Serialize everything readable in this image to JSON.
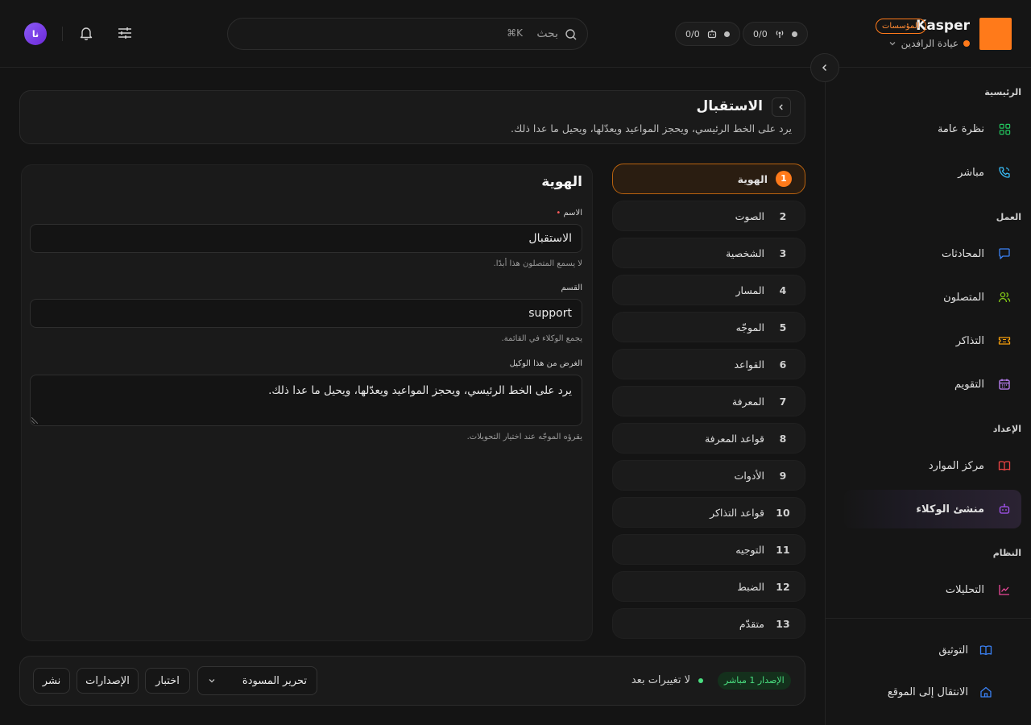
{
  "brand": {
    "name": "Kasper",
    "badge": "المؤسسات",
    "org": "عيادة الرافدين"
  },
  "status_pills": [
    {
      "label": "0/0",
      "icon": "antenna-icon"
    },
    {
      "label": "0/0",
      "icon": "bot-icon"
    }
  ],
  "search": {
    "placeholder": "بحث",
    "shortcut": "⌘K"
  },
  "user": {
    "initials": "نا"
  },
  "sidebar": {
    "sections": [
      {
        "label": "الرئيسية",
        "items": [
          {
            "label": "نظرة عامة",
            "icon": "grid-icon",
            "color": "#22c55e"
          },
          {
            "label": "مباشر",
            "icon": "phone-icon",
            "color": "#38bdf8"
          }
        ]
      },
      {
        "label": "العمل",
        "items": [
          {
            "label": "المحادثات",
            "icon": "chat-icon",
            "color": "#3b82f6"
          },
          {
            "label": "المتصلون",
            "icon": "users-icon",
            "color": "#84cc16"
          },
          {
            "label": "التذاكر",
            "icon": "ticket-icon",
            "color": "#f59e0b"
          },
          {
            "label": "التقويم",
            "icon": "calendar-icon",
            "color": "#c084fc"
          }
        ]
      },
      {
        "label": "الإعداد",
        "items": [
          {
            "label": "مركز الموارد",
            "icon": "book-icon",
            "color": "#ef4444"
          },
          {
            "label": "منشئ الوكلاء",
            "icon": "robot-icon",
            "color": "#a855f7"
          }
        ]
      },
      {
        "label": "النظام",
        "items": [
          {
            "label": "التحليلات",
            "icon": "chart-icon",
            "color": "#ec4899"
          }
        ]
      }
    ],
    "footer": [
      {
        "label": "التوثيق",
        "icon": "book-open-icon"
      },
      {
        "label": "الانتقال إلى الموقع",
        "icon": "home-icon"
      }
    ]
  },
  "header": {
    "title": "الاستقبال",
    "subtitle": "يرد على الخط الرئيسي، ويحجز المواعيد ويعدّلها، ويحيل ما عدا ذلك."
  },
  "steps": [
    {
      "num": "1",
      "label": "الهوية"
    },
    {
      "num": "2",
      "label": "الصوت"
    },
    {
      "num": "3",
      "label": "الشخصية"
    },
    {
      "num": "4",
      "label": "المسار"
    },
    {
      "num": "5",
      "label": "الموجّه"
    },
    {
      "num": "6",
      "label": "القواعد"
    },
    {
      "num": "7",
      "label": "المعرفة"
    },
    {
      "num": "8",
      "label": "قواعد المعرفة"
    },
    {
      "num": "9",
      "label": "الأدوات"
    },
    {
      "num": "10",
      "label": "قواعد التذاكر"
    },
    {
      "num": "11",
      "label": "التوجيه"
    },
    {
      "num": "12",
      "label": "الضبط"
    },
    {
      "num": "13",
      "label": "متقدّم"
    }
  ],
  "identity": {
    "title": "الهوية",
    "name_label": "الاسم",
    "name_value": "الاستقبال",
    "name_hint": "لا يسمع المتصلون هذا أبدًا.",
    "dept_label": "القسم",
    "dept_value": "support",
    "dept_hint": "يجمع الوكلاء في القائمة.",
    "purpose_label": "الغرض من هذا الوكيل",
    "purpose_value": "يرد على الخط الرئيسي، ويحجز المواعيد ويعدّلها، ويحيل ما عدا ذلك.",
    "purpose_hint": "يقرؤه الموجّه عند اختيار التحويلات."
  },
  "footer_bar": {
    "version_badge": "الإصدار 1 مباشر",
    "status": "لا تغييرات بعد",
    "draft_select": "تحرير المسودة",
    "test": "اختبار",
    "versions": "الإصدارات",
    "publish": "نشر"
  }
}
